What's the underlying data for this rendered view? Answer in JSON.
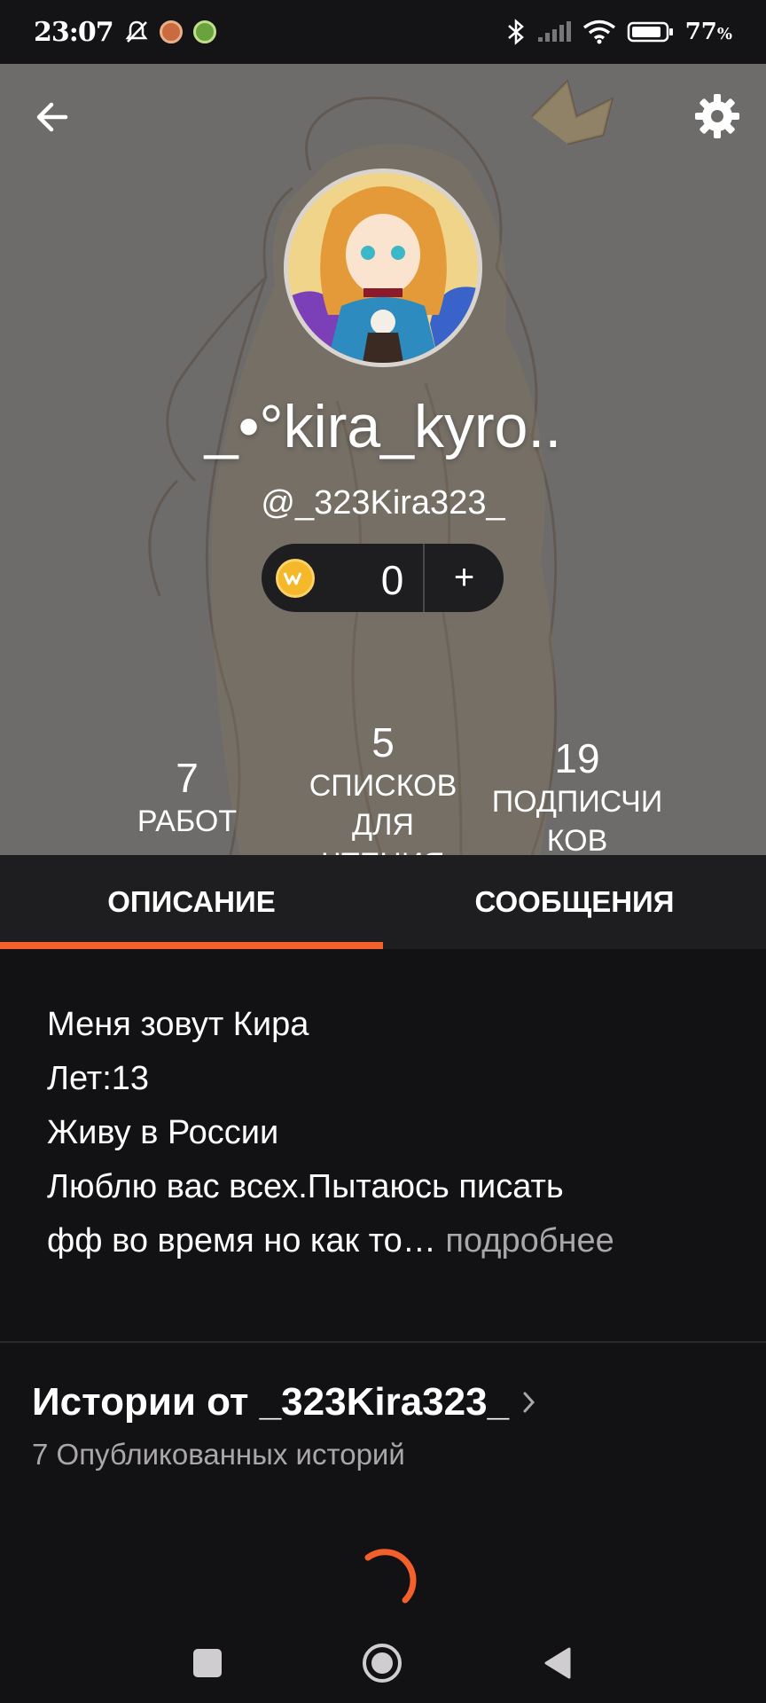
{
  "status_bar": {
    "time": "23:07",
    "battery_percent": "77",
    "battery_unit": "%",
    "icons": [
      "bell-off-icon",
      "app-notification-icon",
      "download-icon",
      "bluetooth-icon",
      "signal-icon",
      "wifi-icon",
      "battery-icon"
    ]
  },
  "profile": {
    "display_name": "_•°kira_kyro..",
    "handle": "@_323Kira323_",
    "coins": "0",
    "coin_add_label": "+",
    "stats": [
      {
        "value": "7",
        "label_lines": [
          "РАБОТ"
        ]
      },
      {
        "value": "5",
        "label_lines": [
          "СПИСКОВ",
          "ДЛЯ",
          "ЧТЕНИЯ"
        ]
      },
      {
        "value": "19",
        "label_lines": [
          "ПОДПИСЧИ",
          "КОВ"
        ]
      }
    ]
  },
  "tabs": [
    {
      "label": "ОПИСАНИЕ",
      "active": true
    },
    {
      "label": "СООБЩЕНИЯ",
      "active": false
    }
  ],
  "description": {
    "lines": [
      "Меня зовут Кира",
      "Лет:13",
      "Живу в России",
      "Люблю вас всех.Пытаюсь писать",
      "фф во время но как то…"
    ],
    "more_label": "подробнее"
  },
  "stories": {
    "title": "Истории от _323Kira323_",
    "subtitle": "7 Опубликованных историй"
  },
  "colors": {
    "accent": "#f4602b",
    "background": "#121113",
    "tab_bar": "#1e1d1f",
    "muted_text": "#a9a7aa"
  }
}
